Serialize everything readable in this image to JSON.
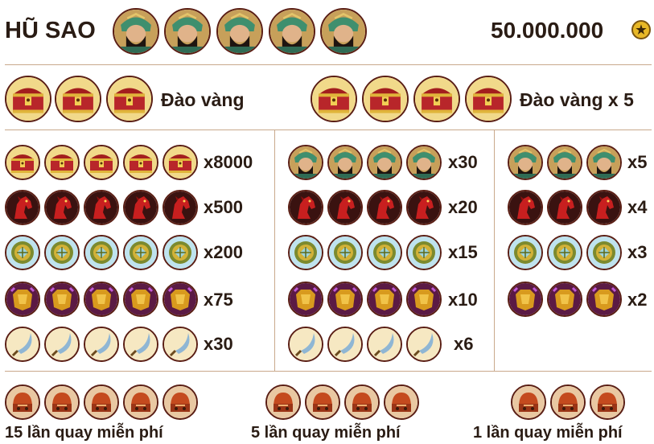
{
  "header": {
    "jackpot_label": "HŨ SAO",
    "jackpot_amount": "50.000.000",
    "coin_icon": "star-coin-icon"
  },
  "bonus": {
    "single_label": "Đào vàng",
    "multi_label": "Đào vàng x 5"
  },
  "paytable": {
    "col5": [
      "x8000",
      "x500",
      "x200",
      "x75",
      "x30"
    ],
    "col4": [
      "x30",
      "x20",
      "x15",
      "x10",
      "x6"
    ],
    "col3": [
      "x5",
      "x4",
      "x3",
      "x2"
    ]
  },
  "free_spins": {
    "five": "15 lần quay miễn phí",
    "four": "5 lần quay miễn phí",
    "three": "1 lần quay miễn phí"
  },
  "symbols": [
    "general-portrait-icon",
    "treasure-chest-icon",
    "red-horse-icon",
    "magic-shield-icon",
    "golden-armor-icon",
    "curved-blade-icon",
    "war-helmet-icon"
  ],
  "colors": {
    "divider": "#c9a98c",
    "text": "#2a1c14",
    "icon_border": "#5a1e14"
  }
}
